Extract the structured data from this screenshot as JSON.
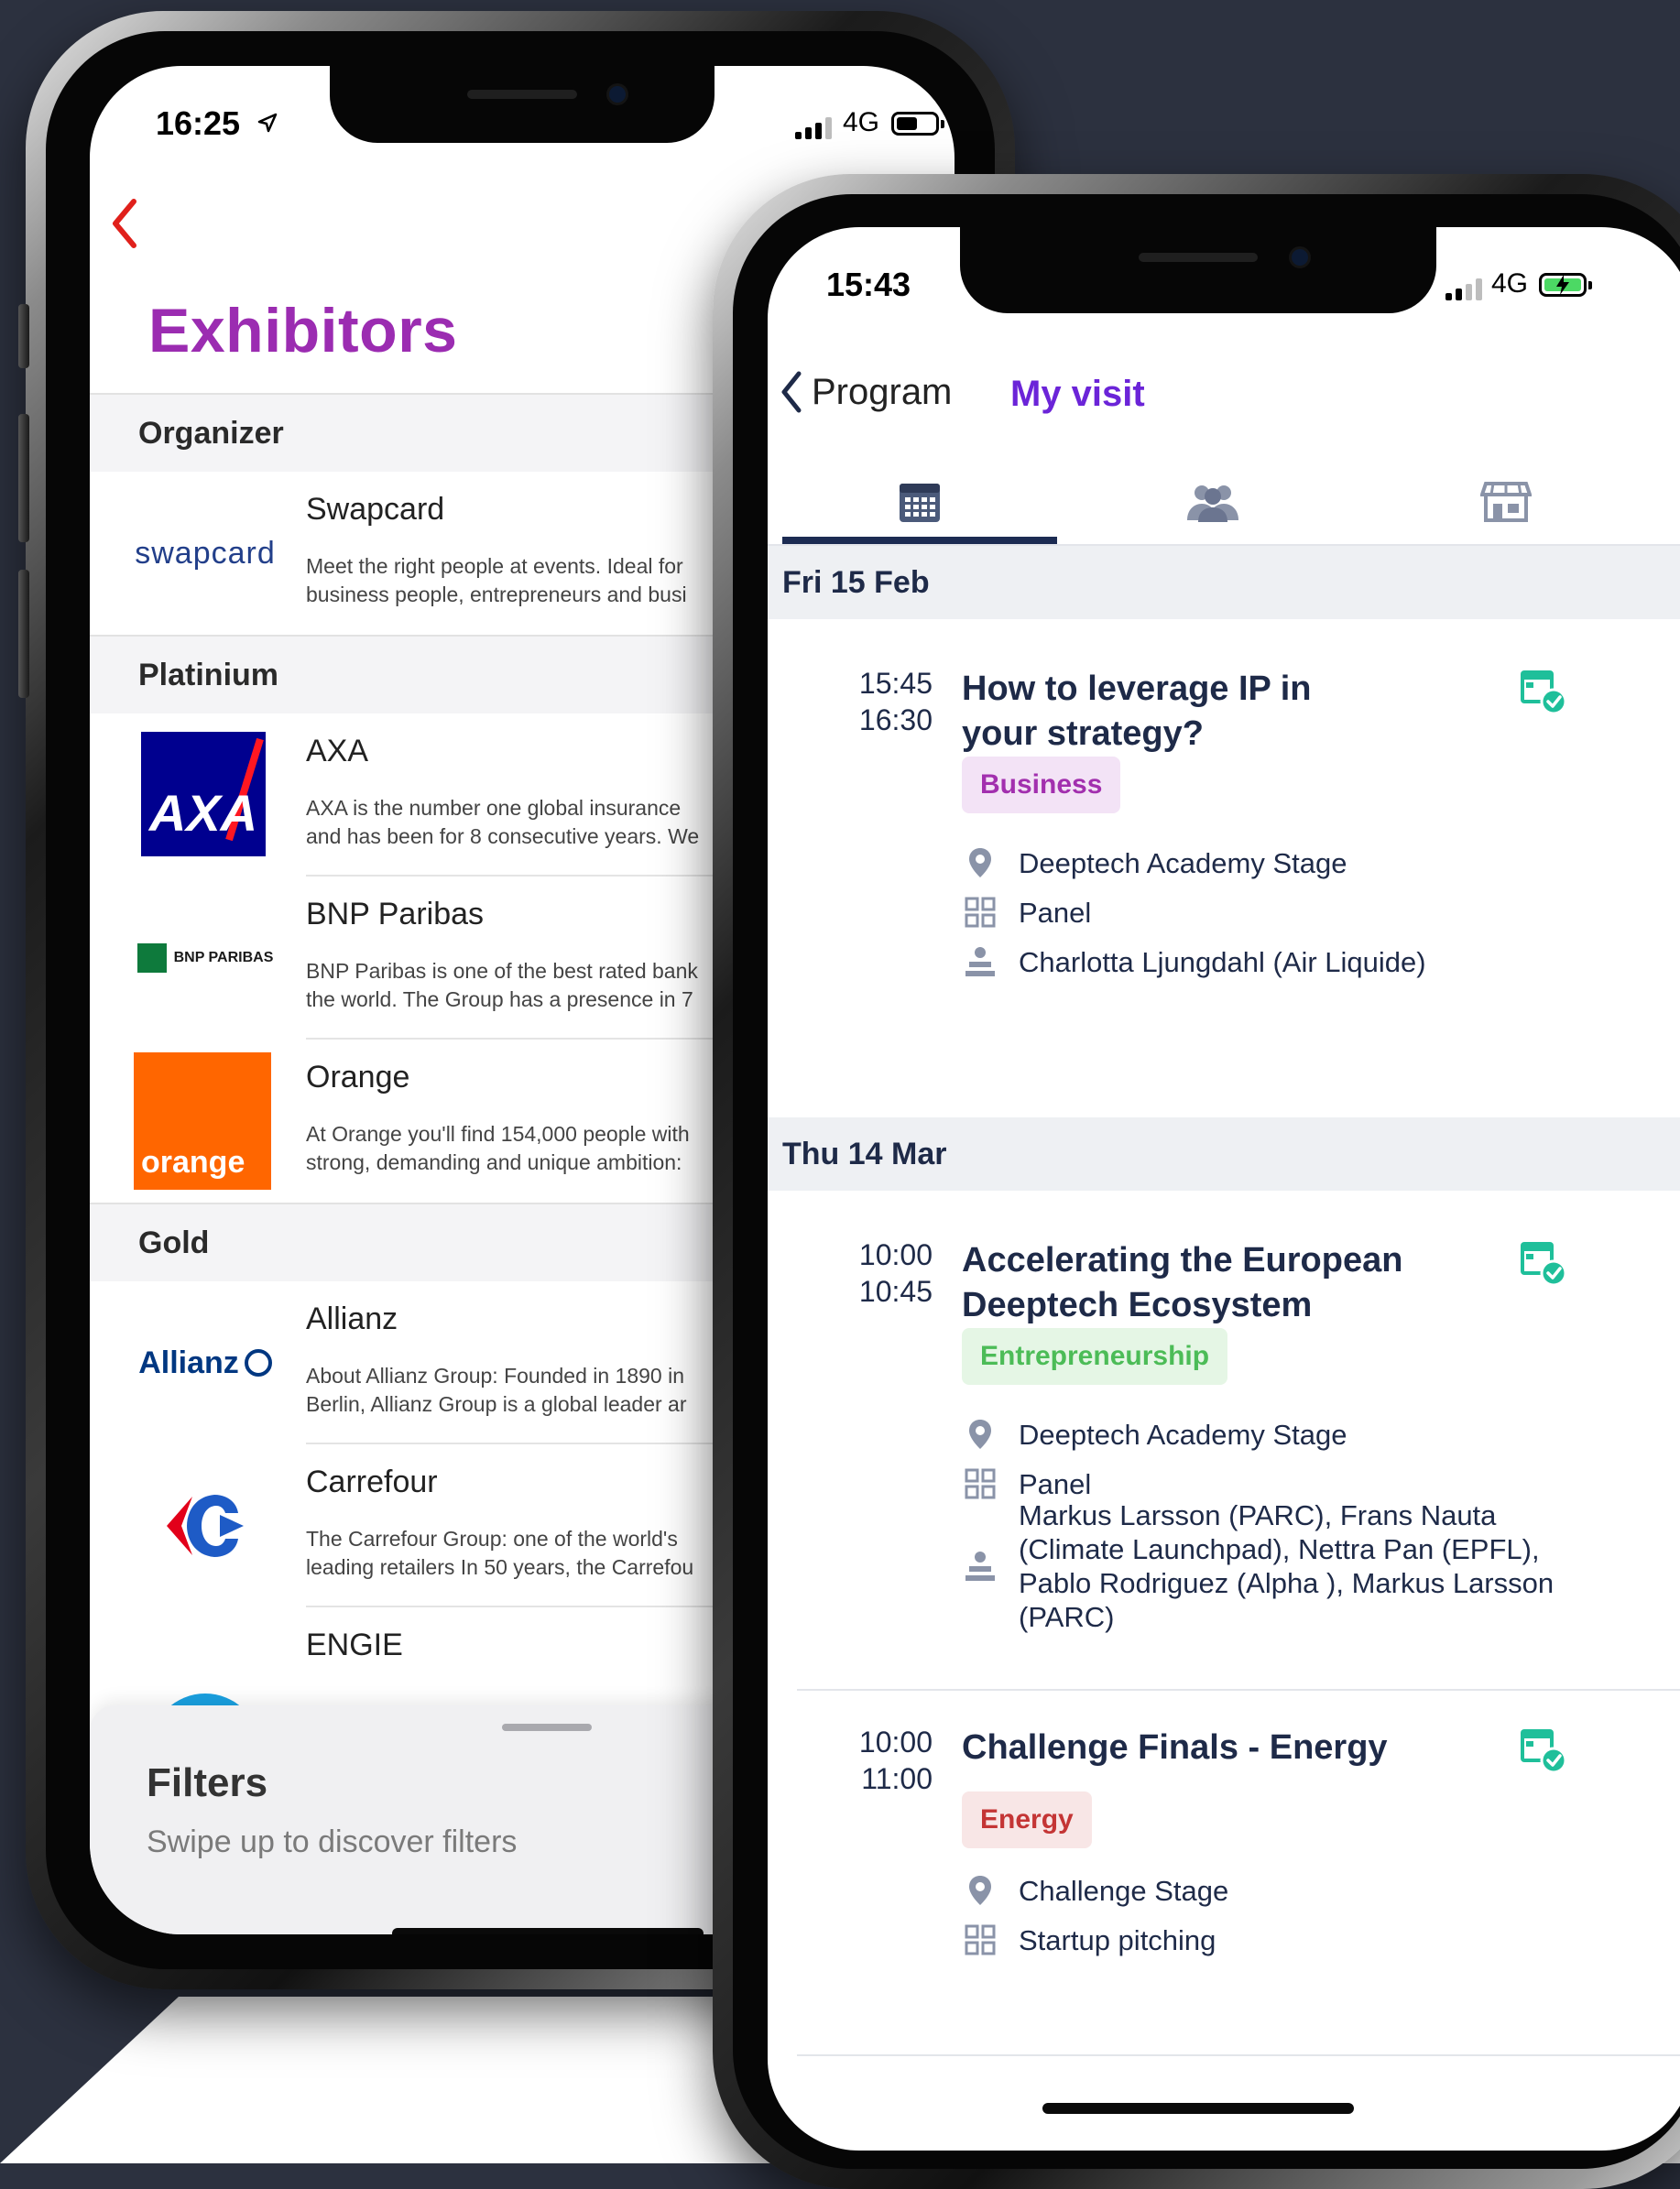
{
  "exhibitors_screen": {
    "time": "16:25",
    "network": "4G",
    "title": "Exhibitors",
    "sections": [
      {
        "header": "Organizer",
        "items": [
          {
            "name": "Swapcard",
            "logo_text": "swapcard",
            "description": "Meet the right people at events. Ideal for\nbusiness people, entrepreneurs and busi"
          }
        ]
      },
      {
        "header": "Platinium",
        "items": [
          {
            "name": "AXA",
            "logo_text": "AXA",
            "description": "AXA is the number one global insurance\nand has been for 8 consecutive years. We"
          },
          {
            "name": "BNP Paribas",
            "logo_text": "BNP PARIBAS",
            "description": "BNP Paribas is one of the best rated bank\nthe world. The Group has a presence in 7"
          },
          {
            "name": "Orange",
            "logo_text": "orange",
            "description": "At Orange you'll find 154,000 people with\nstrong, demanding and unique ambition:"
          }
        ]
      },
      {
        "header": "Gold",
        "items": [
          {
            "name": "Allianz",
            "logo_text": "Allianz",
            "description": "About Allianz Group: Founded in 1890 in\nBerlin, Allianz Group is a global leader ar"
          },
          {
            "name": "Carrefour",
            "logo_text": "",
            "description": "The Carrefour Group: one of the world's\nleading retailers In 50 years, the Carrefou"
          },
          {
            "name": "ENGIE",
            "logo_text": "",
            "description": ""
          }
        ]
      }
    ],
    "filters": {
      "title": "Filters",
      "subtitle": "Swipe up to discover filters"
    }
  },
  "program_screen": {
    "time": "15:43",
    "network": "4G",
    "back_label": "Program",
    "title": "My visit",
    "tabs": [
      "calendar-icon",
      "people-icon",
      "store-icon"
    ],
    "days": [
      {
        "label": "Fri 15 Feb",
        "sessions": [
          {
            "start": "15:45",
            "end": "16:30",
            "title": "How to leverage IP in your strategy?",
            "tag": "Business",
            "location": "Deeptech Academy Stage",
            "format": "Panel",
            "speakers": "Charlotta Ljungdahl  (Air Liquide)"
          }
        ]
      },
      {
        "label": "Thu 14 Mar",
        "sessions": [
          {
            "start": "10:00",
            "end": "10:45",
            "title": "Accelerating the European Deeptech Ecosystem",
            "tag": "Entrepreneurship",
            "location": "Deeptech Academy Stage",
            "format": "Panel",
            "speakers": "Markus Larsson (PARC), Frans Nauta (Climate Launchpad), Nettra Pan (EPFL), Pablo Rodriguez (Alpha ), Markus Larsson (PARC)"
          },
          {
            "start": "10:00",
            "end": "11:00",
            "title": "Challenge Finals - Energy",
            "tag": "Energy",
            "location": "Challenge Stage",
            "format": "Startup pitching",
            "speakers": ""
          }
        ]
      }
    ]
  },
  "colors": {
    "background": "#2c313f",
    "exhibitors_title": "#9b2cb1",
    "back_chevron": "#e0201b",
    "my_visit_title": "#6b24d8",
    "navy_text": "#1e2a48",
    "calendar_check": "#1fbf9a"
  }
}
